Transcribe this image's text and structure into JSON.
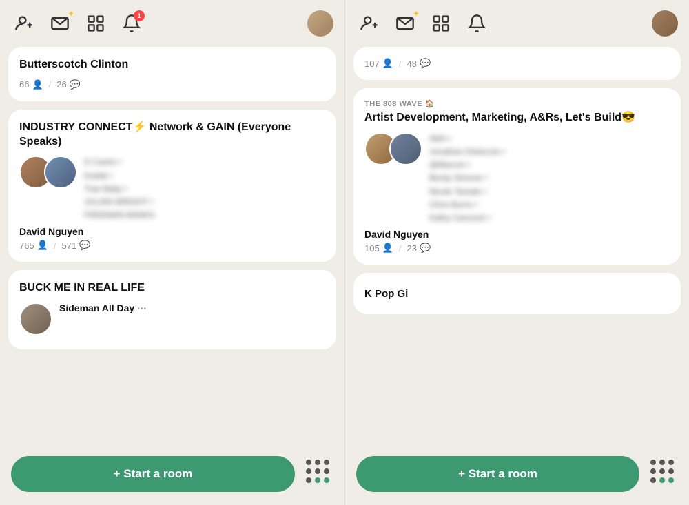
{
  "panels": [
    {
      "id": "left",
      "nav": {
        "add_people_icon": "add-people",
        "mail_icon": "mail",
        "grid_icon": "grid",
        "bell_icon": "bell",
        "bell_badge": "1",
        "avatar_color": "#c4a882"
      },
      "rooms": [
        {
          "id": "butterscotch",
          "title": "Butterscotch Clinton",
          "subtitle": null,
          "speakers_blurred": true,
          "host": null,
          "stats_people": "66",
          "stats_chat": "26",
          "truncated_top": true
        },
        {
          "id": "industry-connect",
          "title": "INDUSTRY CONNECT⚡ Network & GAIN (Everyone Speaks)",
          "subtitle": null,
          "speakers_blurred": true,
          "host": "David Nguyen",
          "stats_people": "765",
          "stats_chat": "571",
          "truncated_top": false
        },
        {
          "id": "buck-me",
          "title": "BUCK ME IN REAL LIFE",
          "subtitle": null,
          "speakers_blurred": true,
          "host": "Sideman All Day",
          "host_suffix": "···",
          "stats_people": null,
          "stats_chat": null,
          "truncated_top": false,
          "partial": true
        }
      ],
      "bottom": {
        "start_room_label": "+ Start a room"
      }
    },
    {
      "id": "right",
      "nav": {
        "add_people_icon": "add-people",
        "mail_icon": "mail",
        "grid_icon": "grid",
        "bell_icon": "bell",
        "bell_badge": null,
        "avatar_color": "#a08060"
      },
      "rooms": [
        {
          "id": "room-107",
          "title": null,
          "subtitle": null,
          "speakers_blurred": true,
          "host": null,
          "stats_people": "107",
          "stats_chat": "48",
          "truncated_top": true
        },
        {
          "id": "808-wave",
          "title": "Artist Development, Marketing, A&Rs, Let's Build😎",
          "subtitle": "THE 808 WAVE 🏠",
          "speakers_blurred": true,
          "host": "David Nguyen",
          "stats_people": "105",
          "stats_chat": "23",
          "truncated_top": false
        },
        {
          "id": "kpop",
          "title": "K Pop Gi",
          "subtitle": null,
          "speakers_blurred": true,
          "host": null,
          "stats_people": null,
          "stats_chat": null,
          "truncated_top": false,
          "partial": true
        }
      ],
      "bottom": {
        "start_room_label": "+ Start a room"
      }
    }
  ]
}
